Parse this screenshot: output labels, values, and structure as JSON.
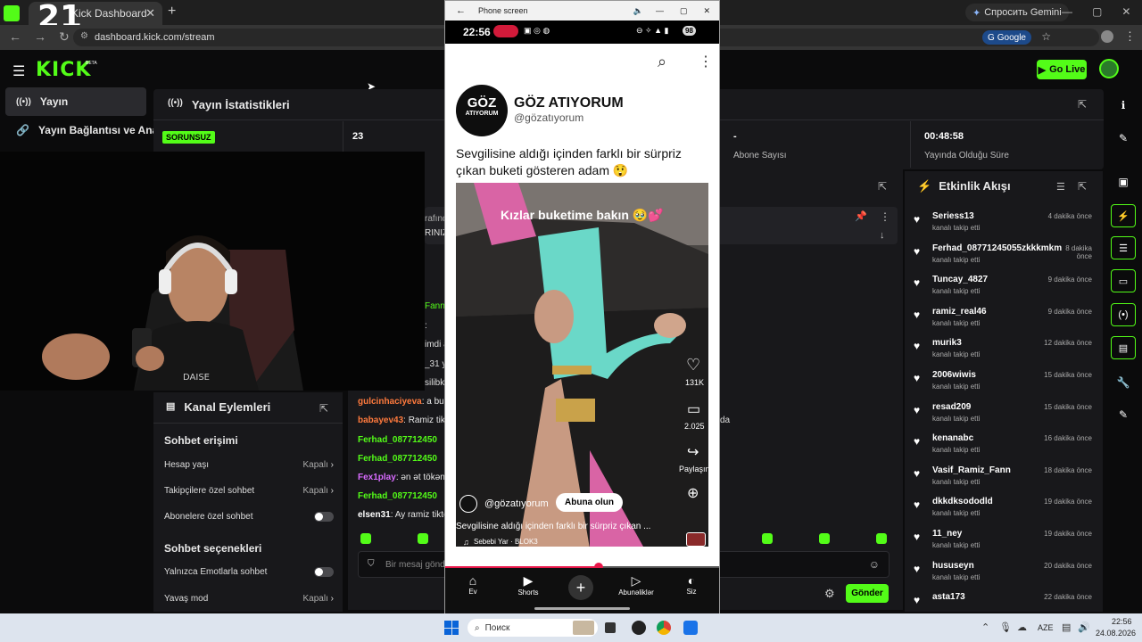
{
  "browser": {
    "tab_title": "Kick Dashboard",
    "url": "dashboard.kick.com/stream",
    "google_chip": "Google",
    "gemini_label": "Спросить Gemini",
    "overlay_number": "21"
  },
  "kick": {
    "logo": "KICK",
    "beta": "BETA",
    "go_live": "Go Live"
  },
  "sidebar": {
    "items": [
      {
        "label": "Yayın"
      },
      {
        "label": "Yayın Bağlantısı ve Anahtar"
      }
    ]
  },
  "stats": {
    "title": "Yayın İstatistikleri",
    "status_badge": "SORUNSUZ",
    "viewers": "23",
    "subscribers_value": "-",
    "subscribers_label": "Abone Sayısı",
    "uptime_value": "00:48:58",
    "uptime_label": "Yayında Olduğu Süre"
  },
  "chat": {
    "partial_lines": [
      "rafınd",
      "RINIZ",
      "Fann",
      ":",
      "imdi a",
      "_31 y",
      "silibk"
    ],
    "side_fragment": "da",
    "messages": [
      {
        "user": "gulcinhaciyeva",
        "text": ": a bu",
        "color": "#ff7a3d"
      },
      {
        "user": "babayev43",
        "text": ": Ramiz tik",
        "color": "#ff7a3d"
      },
      {
        "user": "Ferhad_087712450",
        "text": "",
        "color": "#53fc18"
      },
      {
        "user": "Ferhad_087712450",
        "text": "",
        "color": "#53fc18"
      },
      {
        "user": "Fex1play",
        "text": ": ən ət tökən",
        "color": "#d86bff"
      },
      {
        "user": "Ferhad_087712450",
        "text": "",
        "color": "#53fc18"
      },
      {
        "user": "elsen31",
        "text": ": Ay ramiz tikto",
        "color": "#ffffff"
      }
    ],
    "input_placeholder": "Bir mesaj gönd",
    "send_label": "Gönder"
  },
  "channel_actions": {
    "title": "Kanal Eylemleri",
    "section1": "Sohbet erişimi",
    "rows1": [
      {
        "label": "Hesap yaşı",
        "value": "Kapalı"
      },
      {
        "label": "Takipçilere özel sohbet",
        "value": "Kapalı"
      },
      {
        "label": "Abonelere özel sohbet",
        "value": ""
      }
    ],
    "section2": "Sohbet seçenekleri",
    "rows2": [
      {
        "label": "Yalnızca Emotlarla sohbet",
        "value": ""
      },
      {
        "label": "Yavaş mod",
        "value": "Kapalı"
      }
    ]
  },
  "feed": {
    "title": "Etkinlik Akışı",
    "items": [
      {
        "name": "Seriess13",
        "action": "kanalı takip etti",
        "time": "4 dakika önce"
      },
      {
        "name": "Ferhad_08771245055zkkkmkm",
        "action": "kanalı takip etti",
        "time": "8 dakika önce"
      },
      {
        "name": "Tuncay_4827",
        "action": "kanalı takip etti",
        "time": "9 dakika önce"
      },
      {
        "name": "ramiz_real46",
        "action": "kanalı takip etti",
        "time": "9 dakika önce"
      },
      {
        "name": "murik3",
        "action": "kanalı takip etti",
        "time": "12 dakika önce"
      },
      {
        "name": "2006wiwis",
        "action": "kanalı takip etti",
        "time": "15 dakika önce"
      },
      {
        "name": "resad209",
        "action": "kanalı takip etti",
        "time": "15 dakika önce"
      },
      {
        "name": "kenanabc",
        "action": "kanalı takip etti",
        "time": "16 dakika önce"
      },
      {
        "name": "Vasif_Ramiz_Fann",
        "action": "kanalı takip etti",
        "time": "18 dakika önce"
      },
      {
        "name": "dkkdksododld",
        "action": "kanalı takip etti",
        "time": "19 dakika önce"
      },
      {
        "name": "11_ney",
        "action": "kanalı takip etti",
        "time": "19 dakika önce"
      },
      {
        "name": "hususeyn",
        "action": "kanalı takip etti",
        "time": "20 dakika önce"
      },
      {
        "name": "asta173",
        "action": "",
        "time": "22 dakika önce"
      }
    ]
  },
  "phone": {
    "window_title": "Phone screen",
    "time": "22:56",
    "battery": "98",
    "channel_name": "GÖZ ATIYORUM",
    "channel_handle": "@gözatıyorum",
    "logo_top": "GÖZ",
    "logo_bottom": "ATIYORUM",
    "caption": "Sevgilisine aldığı içinden farklı bir sürpriz çıkan buketi gösteren adam 😲",
    "video_overlay": "Kızlar buketime bakın 🥹💕",
    "likes": "131K",
    "comments": "2.025",
    "share": "Paylaşın",
    "bottom_handle": "@gözatıyorum",
    "subscribe": "Abuna olun",
    "bottom_caption": "Sevgilisine aldığı içinden farklı bir sürpriz çıkan ...",
    "music": "Sebebi Yar · BLOK3",
    "nav": [
      {
        "label": "Ev"
      },
      {
        "label": "Shorts"
      },
      {
        "label": ""
      },
      {
        "label": "Abunəliklər"
      },
      {
        "label": "Siz"
      }
    ]
  },
  "taskbar": {
    "search_placeholder": "Поиск",
    "lang": "AZE",
    "time": "22:56",
    "date": "24.08.2026"
  }
}
